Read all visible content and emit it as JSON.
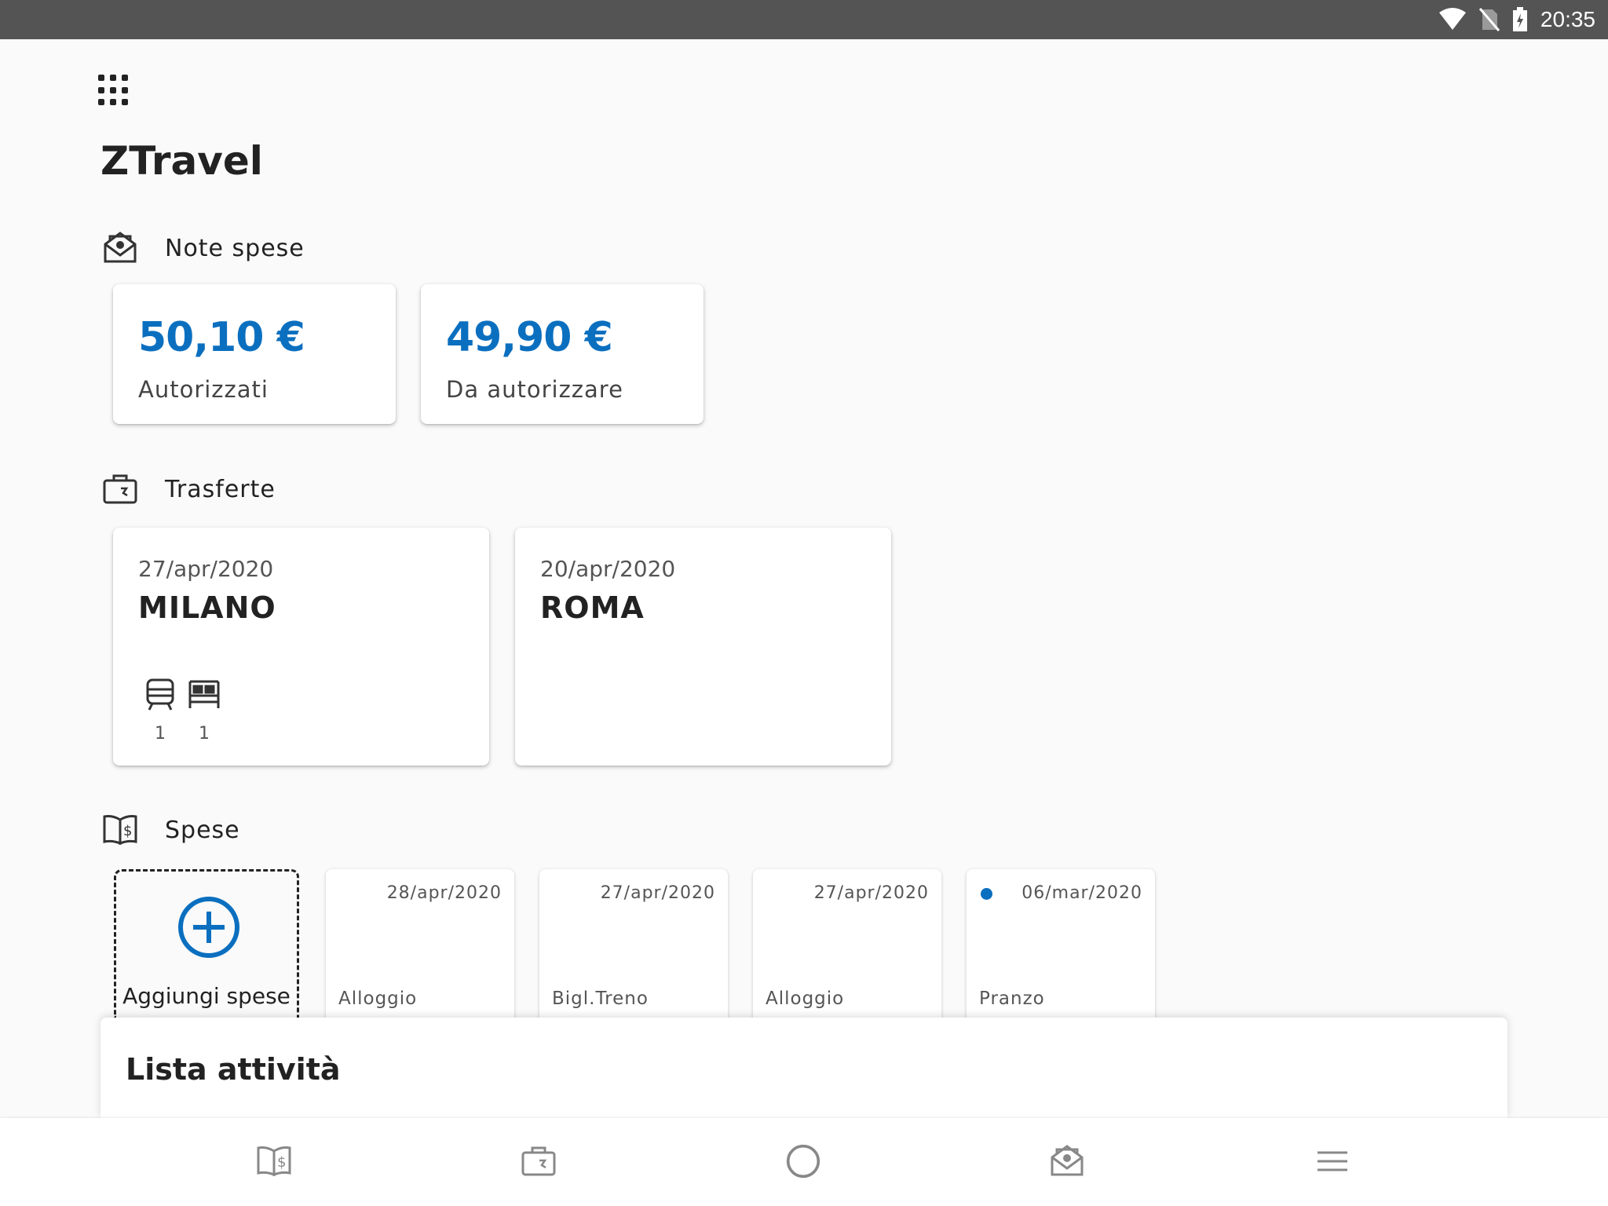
{
  "status_bar": {
    "time": "20:35"
  },
  "app": {
    "title": "ZTravel"
  },
  "note_spese": {
    "title": "Note spese",
    "authorized": {
      "amount": "50,10 €",
      "label": "Autorizzati"
    },
    "pending": {
      "amount": "49,90 €",
      "label": "Da autorizzare"
    }
  },
  "trasferte": {
    "title": "Trasferte",
    "trips": [
      {
        "date": "27/apr/2020",
        "city": "MILANO",
        "train_count": "1",
        "hotel_count": "1"
      },
      {
        "date": "20/apr/2020",
        "city": "ROMA"
      }
    ]
  },
  "spese": {
    "title": "Spese",
    "add_label": "Aggiungi spese",
    "items": [
      {
        "date": "28/apr/2020",
        "type": "Alloggio"
      },
      {
        "date": "27/apr/2020",
        "type": "Bigl.Treno"
      },
      {
        "date": "27/apr/2020",
        "type": "Alloggio"
      },
      {
        "date": "06/mar/2020",
        "type": "Pranzo"
      }
    ]
  },
  "activity_sheet": {
    "title": "Lista attività"
  },
  "colors": {
    "accent": "#0b6fbf",
    "status_bar": "#545454",
    "background": "#fafafa"
  }
}
